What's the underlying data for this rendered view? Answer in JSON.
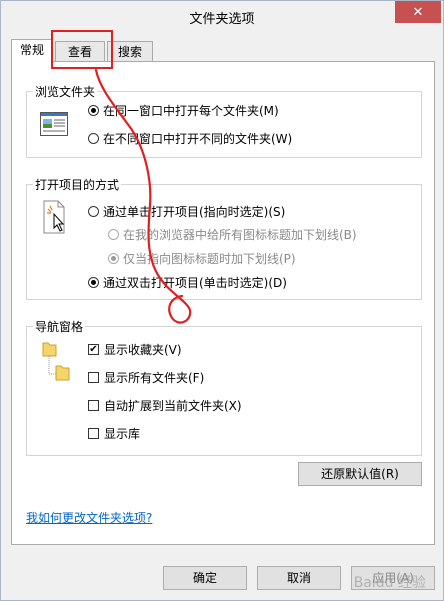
{
  "window": {
    "title": "文件夹选项",
    "close_label": "✕"
  },
  "tabs": [
    {
      "label": "常规",
      "active": true
    },
    {
      "label": "查看",
      "active": false
    },
    {
      "label": "搜索",
      "active": false
    }
  ],
  "browse_group": {
    "legend": "浏览文件夹",
    "options": [
      {
        "label": "在同一窗口中打开每个文件夹(M)",
        "selected": true
      },
      {
        "label": "在不同窗口中打开不同的文件夹(W)",
        "selected": false
      }
    ]
  },
  "open_group": {
    "legend": "打开项目的方式",
    "options": [
      {
        "label": "通过单击打开项目(指向时选定)(S)",
        "selected": false
      },
      {
        "label": "在我的浏览器中给所有图标标题加下划线(B)",
        "selected": false,
        "disabled": true
      },
      {
        "label": "仅当指向图标标题时加下划线(P)",
        "selected": true,
        "disabled": true
      },
      {
        "label": "通过双击打开项目(单击时选定)(D)",
        "selected": true
      }
    ]
  },
  "nav_group": {
    "legend": "导航窗格",
    "options": [
      {
        "label": "显示收藏夹(V)",
        "checked": true
      },
      {
        "label": "显示所有文件夹(F)",
        "checked": false
      },
      {
        "label": "自动扩展到当前文件夹(X)",
        "checked": false
      },
      {
        "label": "显示库",
        "checked": false
      }
    ]
  },
  "restore_button": "还原默认值(R)",
  "help_link": "我如何更改文件夹选项?",
  "footer": {
    "ok": "确定",
    "cancel": "取消",
    "apply": "应用(A)"
  },
  "watermark": "Baidu 经验",
  "colors": {
    "highlight": "#e02020",
    "link": "#0066cc"
  }
}
